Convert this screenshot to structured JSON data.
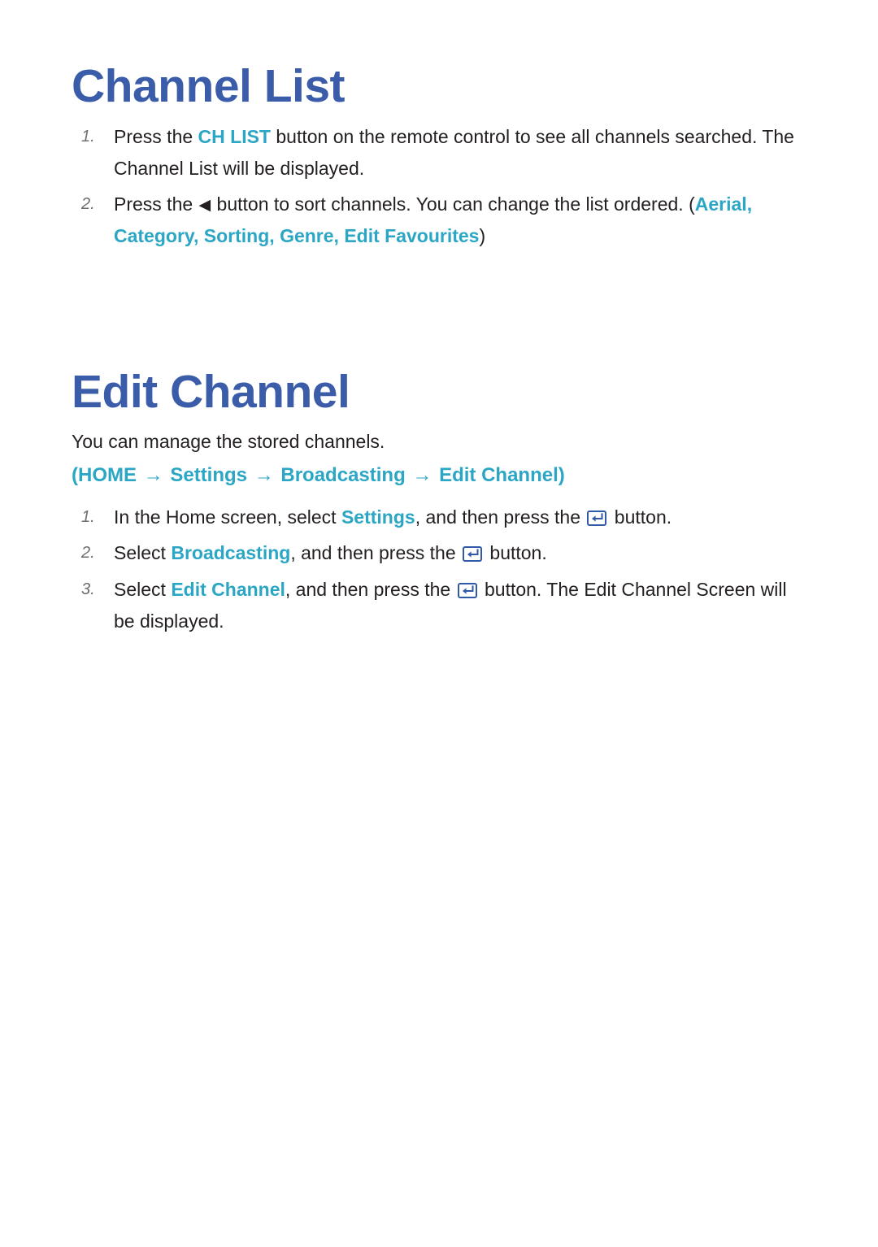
{
  "colors": {
    "heading_blue": "#3a5ca9",
    "accent_cyan": "#2ba6c4",
    "body_text": "#231f20",
    "step_number": "#6d6e71",
    "background": "#ffffff"
  },
  "icons": {
    "enter_button": "enter-key-icon",
    "left_arrow": "◀"
  },
  "sections": [
    {
      "title": "Channel List",
      "steps": [
        {
          "number": "1.",
          "parts": [
            {
              "t": "Press the ",
              "s": "plain"
            },
            {
              "t": "CH LIST",
              "s": "accent-bold"
            },
            {
              "t": " button on the remote control to see all channels searched. The Channel List will be displayed.",
              "s": "plain"
            }
          ]
        },
        {
          "number": "2.",
          "parts": [
            {
              "t": "Press the ",
              "s": "plain"
            },
            {
              "t": "◀",
              "s": "triangle"
            },
            {
              "t": " button to sort channels. You can change the list ordered. (",
              "s": "plain"
            },
            {
              "t": "Aerial",
              "s": "accent-bold"
            },
            {
              "t": ", ",
              "s": "accent-bold"
            },
            {
              "t": "Category",
              "s": "accent-bold"
            },
            {
              "t": ", ",
              "s": "accent-bold"
            },
            {
              "t": "Sorting",
              "s": "accent-bold"
            },
            {
              "t": ", ",
              "s": "accent-bold"
            },
            {
              "t": "Genre",
              "s": "accent-bold"
            },
            {
              "t": ", ",
              "s": "accent-bold"
            },
            {
              "t": "Edit Favourites",
              "s": "accent-bold"
            },
            {
              "t": ")",
              "s": "plain"
            }
          ]
        }
      ]
    },
    {
      "title": "Edit Channel",
      "lead": "You can manage the stored channels.",
      "path": [
        {
          "t": "(",
          "s": "accent-bold"
        },
        {
          "t": "HOME",
          "s": "accent-bold"
        },
        {
          "t": " → ",
          "s": "arrow"
        },
        {
          "t": "Settings",
          "s": "accent-bold"
        },
        {
          "t": " → ",
          "s": "arrow"
        },
        {
          "t": "Broadcasting",
          "s": "accent-bold"
        },
        {
          "t": " → ",
          "s": "arrow"
        },
        {
          "t": "Edit Channel",
          "s": "accent-bold"
        },
        {
          "t": ")",
          "s": "accent-bold"
        }
      ],
      "steps": [
        {
          "number": "1.",
          "parts": [
            {
              "t": "In the Home screen, select ",
              "s": "plain"
            },
            {
              "t": "Settings",
              "s": "accent-bold"
            },
            {
              "t": ", and then press the ",
              "s": "plain"
            },
            {
              "t": "enter-key-icon",
              "s": "enter-key"
            },
            {
              "t": " button.",
              "s": "plain"
            }
          ]
        },
        {
          "number": "2.",
          "parts": [
            {
              "t": "Select ",
              "s": "plain"
            },
            {
              "t": "Broadcasting",
              "s": "accent-bold"
            },
            {
              "t": ", and then press the ",
              "s": "plain"
            },
            {
              "t": "enter-key-icon",
              "s": "enter-key"
            },
            {
              "t": " button.",
              "s": "plain"
            }
          ]
        },
        {
          "number": "3.",
          "parts": [
            {
              "t": "Select ",
              "s": "plain"
            },
            {
              "t": "Edit Channel",
              "s": "accent-bold"
            },
            {
              "t": ", and then press the ",
              "s": "plain"
            },
            {
              "t": "enter-key-icon",
              "s": "enter-key"
            },
            {
              "t": " button. The Edit Channel Screen will be displayed.",
              "s": "plain"
            }
          ]
        }
      ]
    }
  ]
}
